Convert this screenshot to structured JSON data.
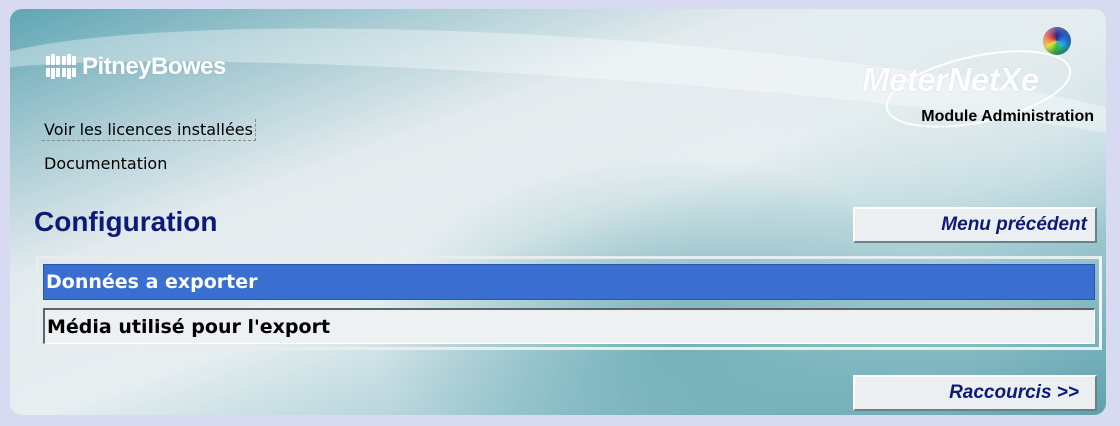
{
  "brand": {
    "company": "PitneyBowes",
    "product": "MeterNetXe",
    "module": "Module Administration"
  },
  "links": {
    "licences": "Voir les licences installées",
    "documentation": "Documentation"
  },
  "section": {
    "title": "Configuration"
  },
  "nav": {
    "previous_menu": "Menu précédent",
    "shortcuts": "Raccourcis >>"
  },
  "options": [
    {
      "label": "Données a exporter",
      "selected": true
    },
    {
      "label": "Média utilisé pour l'export",
      "selected": false
    }
  ],
  "colors": {
    "title_blue": "#0d1b78",
    "selected_row": "#3a6ed0"
  },
  "icons": {
    "pitney_bowes_logo": "pitney-bowes-logo-icon",
    "meternet_logo": "meternet-logo-icon",
    "color_sphere": "color-sphere-icon"
  }
}
